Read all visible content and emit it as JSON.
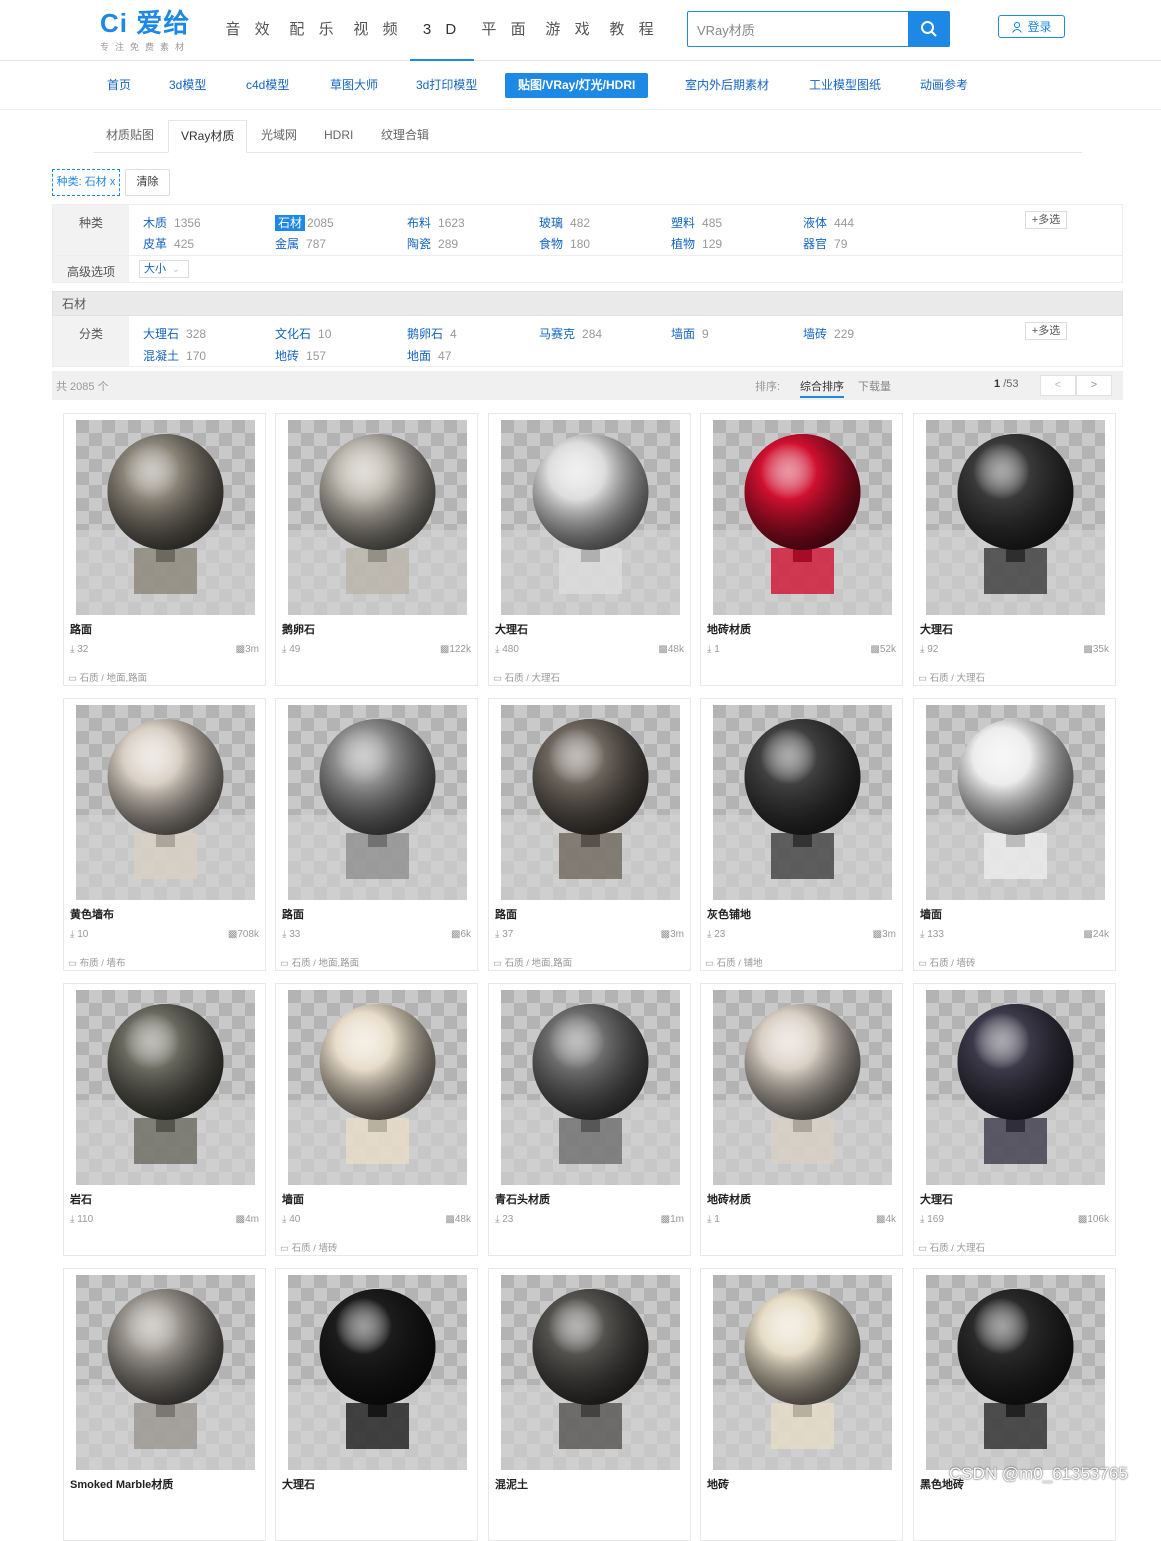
{
  "header": {
    "logo": "Ci 爱给",
    "logo_sub": "专注免费素材",
    "nav": [
      "音 效",
      "配 乐",
      "视 频",
      "3 D",
      "平 面",
      "游 戏",
      "教 程"
    ],
    "nav_active_index": 3,
    "search_value": "VRay材质",
    "login_label": "登录"
  },
  "categories": [
    "首页",
    "3d模型",
    "c4d模型",
    "草图大师",
    "3d打印模型",
    "贴图/VRay/灯光/HDRI",
    "室内外后期素材",
    "工业模型图纸",
    "动画参考"
  ],
  "categories_active_index": 5,
  "subtabs": [
    "材质贴图",
    "VRay材质",
    "光域网",
    "HDRI",
    "纹理合辑"
  ],
  "subtabs_active_index": 1,
  "chip_label": "种类: 石材 x",
  "clear_label": "清除",
  "filter_kind": {
    "label": "种类",
    "items": [
      {
        "name": "木质",
        "count": "1356"
      },
      {
        "name": "石材",
        "count": "2085"
      },
      {
        "name": "布料",
        "count": "1623"
      },
      {
        "name": "玻璃",
        "count": "482"
      },
      {
        "name": "塑料",
        "count": "485"
      },
      {
        "name": "液体",
        "count": "444"
      },
      {
        "name": "皮革",
        "count": "425"
      },
      {
        "name": "金属",
        "count": "787"
      },
      {
        "name": "陶瓷",
        "count": "289"
      },
      {
        "name": "食物",
        "count": "180"
      },
      {
        "name": "植物",
        "count": "129"
      },
      {
        "name": "器官",
        "count": "79"
      }
    ],
    "selected_index": 1,
    "multi_label": "+多选"
  },
  "advanced": {
    "label": "高级选项",
    "size_select": "大小"
  },
  "stone": {
    "heading": "石材",
    "label": "分类",
    "items": [
      {
        "name": "大理石",
        "count": "328"
      },
      {
        "name": "文化石",
        "count": "10"
      },
      {
        "name": "鹅卵石",
        "count": "4"
      },
      {
        "name": "马赛克",
        "count": "284"
      },
      {
        "name": "墙面",
        "count": "9"
      },
      {
        "name": "墙砖",
        "count": "229"
      },
      {
        "name": "混凝土",
        "count": "170"
      },
      {
        "name": "地砖",
        "count": "157"
      },
      {
        "name": "地面",
        "count": "47"
      }
    ],
    "multi_label": "+多选"
  },
  "bar": {
    "total": "共 2085 个",
    "sort_label": "排序:",
    "sort_options": [
      "综合排序",
      "下载量"
    ],
    "page_current": "1",
    "page_total": "/53",
    "prev": "<",
    "next": ">"
  },
  "cards": [
    {
      "title": "路面",
      "downloads": "32",
      "size": "3m",
      "tags": "石质 / 地面,路面"
    },
    {
      "title": "鹅卵石",
      "downloads": "49",
      "size": "122k",
      "tags": ""
    },
    {
      "title": "大理石",
      "downloads": "480",
      "size": "48k",
      "tags": "石质 / 大理石"
    },
    {
      "title": "地砖材质",
      "downloads": "1",
      "size": "52k",
      "tags": ""
    },
    {
      "title": "大理石",
      "downloads": "92",
      "size": "35k",
      "tags": "石质 / 大理石"
    },
    {
      "title": "黄色墙布",
      "downloads": "10",
      "size": "708k",
      "tags": "布质 / 墙布"
    },
    {
      "title": "路面",
      "downloads": "33",
      "size": "6k",
      "tags": "石质 / 地面,路面"
    },
    {
      "title": "路面",
      "downloads": "37",
      "size": "3m",
      "tags": "石质 / 地面,路面"
    },
    {
      "title": "灰色铺地",
      "downloads": "23",
      "size": "3m",
      "tags": "石质 / 铺地"
    },
    {
      "title": "墙面",
      "downloads": "133",
      "size": "24k",
      "tags": "石质 / 墙砖"
    },
    {
      "title": "岩石",
      "downloads": "110",
      "size": "4m",
      "tags": ""
    },
    {
      "title": "墙面",
      "downloads": "40",
      "size": "48k",
      "tags": "石质 / 墙砖"
    },
    {
      "title": "青石头材质",
      "downloads": "23",
      "size": "1m",
      "tags": ""
    },
    {
      "title": "地砖材质",
      "downloads": "1",
      "size": "4k",
      "tags": ""
    },
    {
      "title": "大理石",
      "downloads": "169",
      "size": "106k",
      "tags": "石质 / 大理石"
    },
    {
      "title": "Smoked Marble材质",
      "downloads": "",
      "size": "",
      "tags": ""
    },
    {
      "title": "大理石",
      "downloads": "",
      "size": "",
      "tags": ""
    },
    {
      "title": "混泥土",
      "downloads": "",
      "size": "",
      "tags": ""
    },
    {
      "title": "地砖",
      "downloads": "",
      "size": "",
      "tags": ""
    },
    {
      "title": "黑色地砖",
      "downloads": "",
      "size": "",
      "tags": ""
    }
  ],
  "sphere_colors": [
    "#8a8478",
    "#b9b4aa",
    "#dcdcdc",
    "#d01030",
    "#3a3a3a",
    "#d8cfc4",
    "#8e8e8e",
    "#6e665e",
    "#404040",
    "#ececec",
    "#6b6a60",
    "#e7dcc8",
    "#6d6d6d",
    "#d8cfc4",
    "#3c3a4a",
    "#9a958e",
    "#1c1c1c",
    "#555350",
    "#e6dcc6",
    "#2a2a2a"
  ],
  "watermark_text": "CSDN @m0_61353765",
  "colors": {
    "accent": "#1e88e5",
    "link": "#1565c0"
  }
}
